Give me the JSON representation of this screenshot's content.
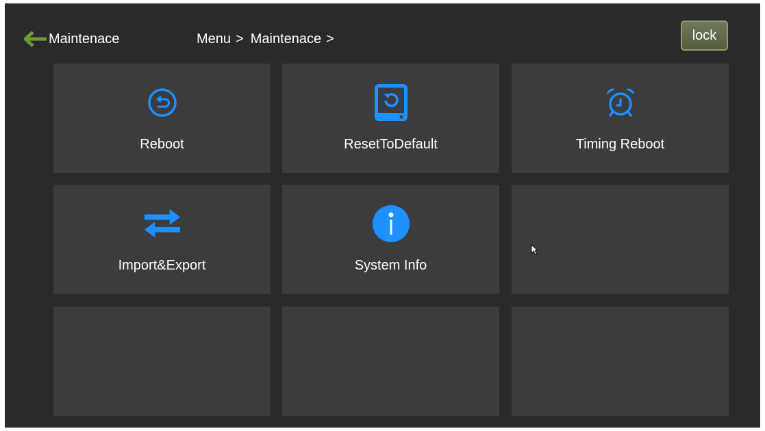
{
  "header": {
    "back_label": "Maintenace",
    "breadcrumb": [
      {
        "label": "Menu"
      },
      {
        "label": "Maintenace"
      }
    ],
    "breadcrumb_separator": ">",
    "lock_label": "lock"
  },
  "tiles": [
    {
      "label": "Reboot",
      "icon": "reboot-icon"
    },
    {
      "label": "ResetToDefault",
      "icon": "reset-to-default-icon"
    },
    {
      "label": "Timing Reboot",
      "icon": "alarm-clock-icon"
    },
    {
      "label": "Import&Export",
      "icon": "import-export-icon"
    },
    {
      "label": "System Info",
      "icon": "info-icon"
    },
    {
      "label": "",
      "icon": ""
    },
    {
      "label": "",
      "icon": ""
    },
    {
      "label": "",
      "icon": ""
    },
    {
      "label": "",
      "icon": ""
    }
  ],
  "colors": {
    "background": "#2a2a2c",
    "tile": "#3c3c3e",
    "accent": "#1e90ff",
    "back_arrow": "#6e9a2e",
    "lock_button": "#5f6a4a"
  }
}
